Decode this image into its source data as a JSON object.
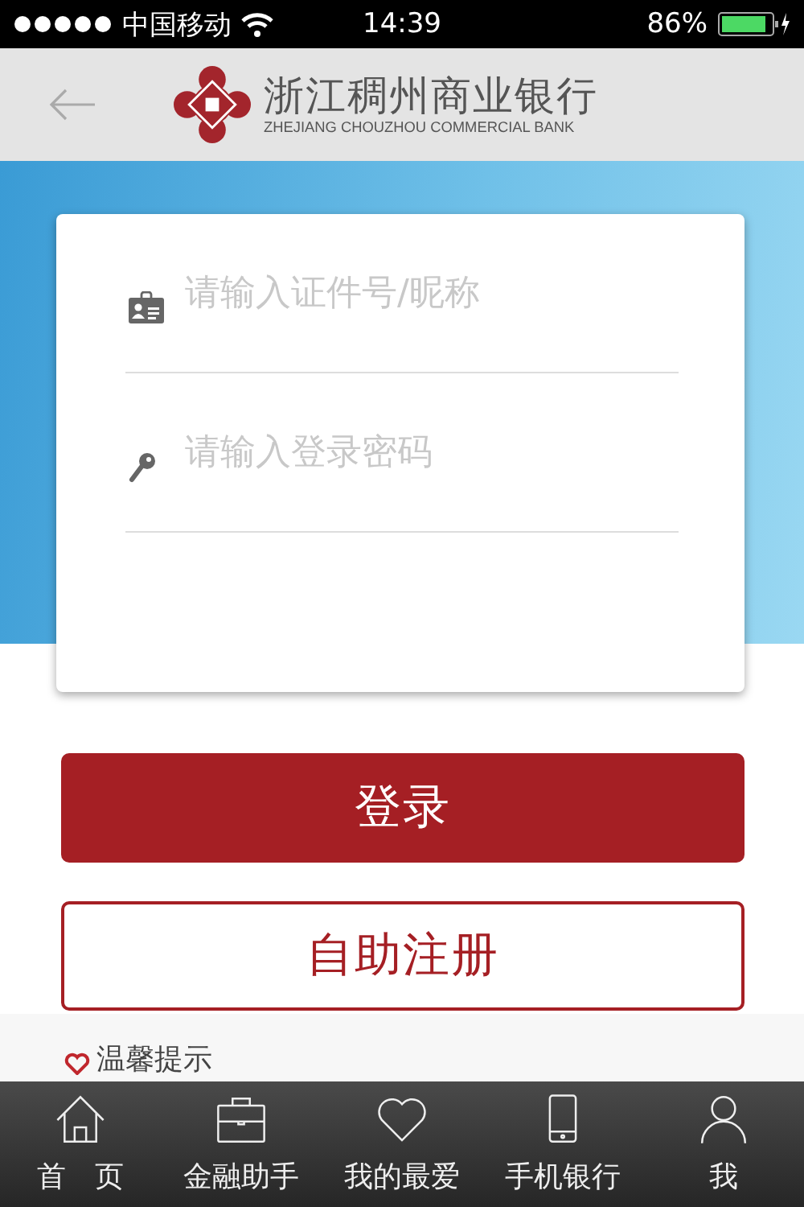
{
  "status_bar": {
    "carrier": "中国移动",
    "time": "14:39",
    "battery": "86%"
  },
  "header": {
    "bank_name": "浙江稠州商业银行",
    "bank_name_en": "ZHEJIANG CHOUZHOU COMMERCIAL BANK"
  },
  "login_form": {
    "fields": [
      {
        "kind": "id",
        "placeholder": "请输入证件号/昵称"
      },
      {
        "kind": "password",
        "placeholder": "请输入登录密码"
      }
    ]
  },
  "buttons": [
    {
      "kind": "primary",
      "label": "登录"
    },
    {
      "kind": "outline",
      "label": "自助注册"
    }
  ],
  "tip": {
    "title": "温馨提示"
  },
  "tab_bar": [
    {
      "kind": "home",
      "label": "首　页"
    },
    {
      "kind": "briefcase",
      "label": "金融助手"
    },
    {
      "kind": "heart",
      "label": "我的最爱"
    },
    {
      "kind": "phone",
      "label": "手机银行"
    },
    {
      "kind": "person",
      "label": "我"
    }
  ]
}
